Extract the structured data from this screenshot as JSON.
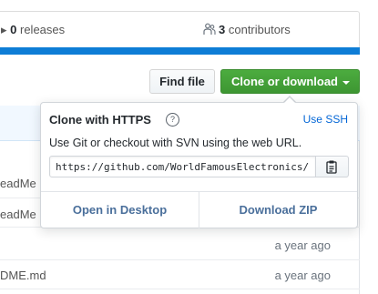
{
  "summary": {
    "releases_count": "0",
    "releases_label": "releases",
    "contributors_count": "3",
    "contributors_label": "contributors",
    "contributors_icon": "people-icon"
  },
  "toolbar": {
    "find_file_label": "Find file",
    "clone_label": "Clone or download",
    "clone_color": "#3d9632"
  },
  "clone_popup": {
    "title": "Clone with HTTPS",
    "help_glyph": "?",
    "switch_label": "Use SSH",
    "description": "Use Git or checkout with SVN using the web URL.",
    "url_value": "https://github.com/WorldFamousElectronics/",
    "copy_icon": "clipboard-icon",
    "open_desktop_label": "Open in Desktop",
    "download_zip_label": "Download ZIP"
  },
  "files": [
    {
      "name": "eadMe",
      "age": ""
    },
    {
      "name": "eadMe",
      "age": ""
    },
    {
      "name": "",
      "age": "a year ago"
    },
    {
      "name": "DME.md",
      "age": "a year ago"
    }
  ]
}
